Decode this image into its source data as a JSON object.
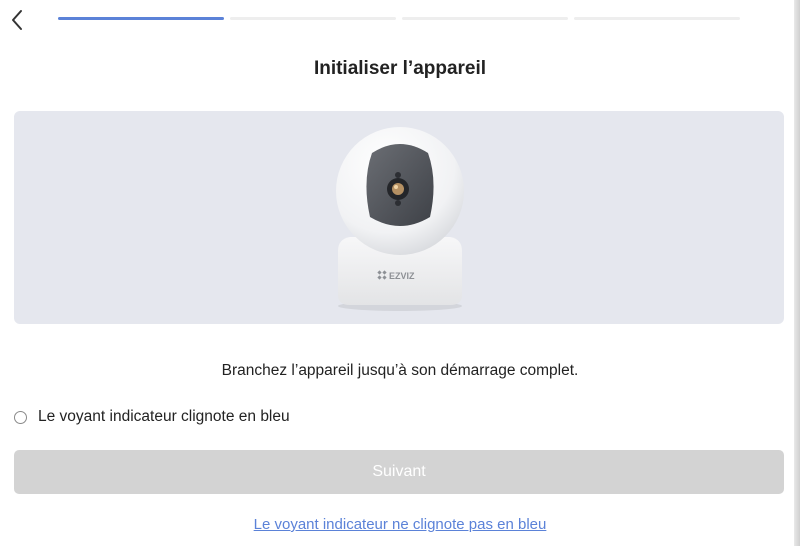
{
  "nav": {
    "back_icon": "chevron-left-icon"
  },
  "progress": {
    "total_steps": 4,
    "current_step": 1,
    "active_color": "#5b82d8"
  },
  "page": {
    "title": "Initialiser l’appareil"
  },
  "device_image": {
    "brand_logo": "EZVIZ",
    "background_color": "#e5e7ee"
  },
  "instruction": "Branchez l’appareil jusqu’à son démarrage complet.",
  "checkbox": {
    "label": "Le voyant indicateur clignote en bleu",
    "checked": false
  },
  "next_button": {
    "label": "Suivant",
    "enabled": false
  },
  "help_link": {
    "label": "Le voyant indicateur ne clignote pas en bleu",
    "color": "#5b82d8"
  }
}
